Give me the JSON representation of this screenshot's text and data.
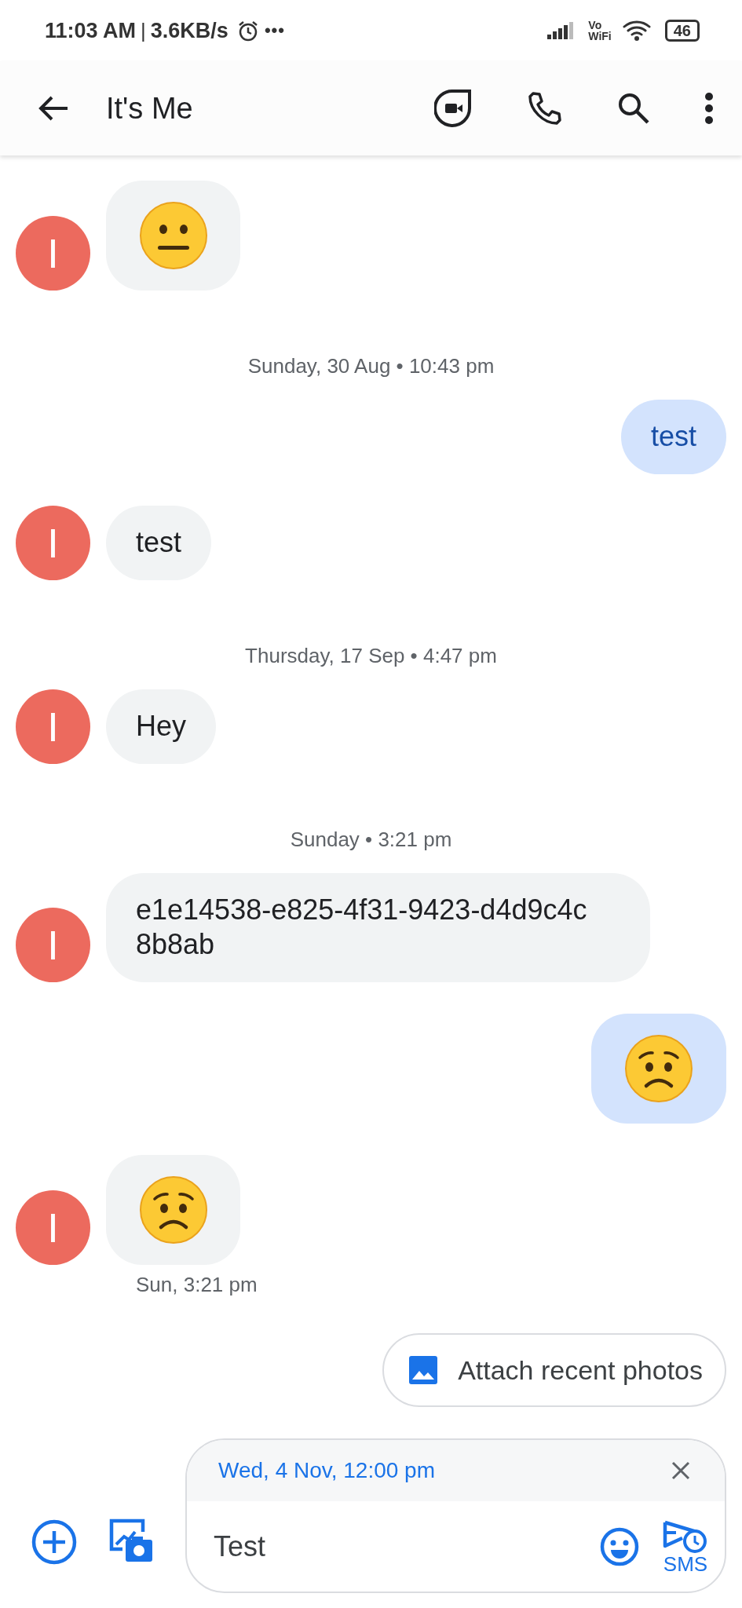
{
  "status_bar": {
    "time": "11:03 AM",
    "separator": "|",
    "speed": "3.6KB/s",
    "more": "•••",
    "vo": "Vo",
    "wifi": "WiFi",
    "battery": "46"
  },
  "header": {
    "title": "It's Me"
  },
  "messages": [
    {
      "kind": "incoming",
      "emoji": {
        "kind": "neutral"
      },
      "avatar": "I"
    },
    {
      "kind": "timestamp",
      "text": "Sunday, 30 Aug • 10:43 pm"
    },
    {
      "kind": "outgoing",
      "text": "test"
    },
    {
      "kind": "incoming",
      "text": "test",
      "avatar": "I"
    },
    {
      "kind": "timestamp",
      "text": "Thursday, 17 Sep • 4:47 pm"
    },
    {
      "kind": "incoming",
      "text": "Hey",
      "avatar": "I"
    },
    {
      "kind": "timestamp",
      "text": "Sunday • 3:21 pm"
    },
    {
      "kind": "incoming",
      "text": "e1e14538-e825-4f31-9423-d4d9c4c 8b8ab",
      "avatar": "I"
    },
    {
      "kind": "outgoing",
      "emoji": {
        "kind": "worried"
      }
    },
    {
      "kind": "incoming",
      "emoji": {
        "kind": "worried"
      },
      "avatar": "I",
      "meta": "Sun, 3:21 pm"
    }
  ],
  "attach_chip": {
    "label": "Attach recent photos"
  },
  "compose": {
    "scheduled": "Wed, 4 Nov, 12:00 pm",
    "value": "Test",
    "send_label": "SMS"
  }
}
